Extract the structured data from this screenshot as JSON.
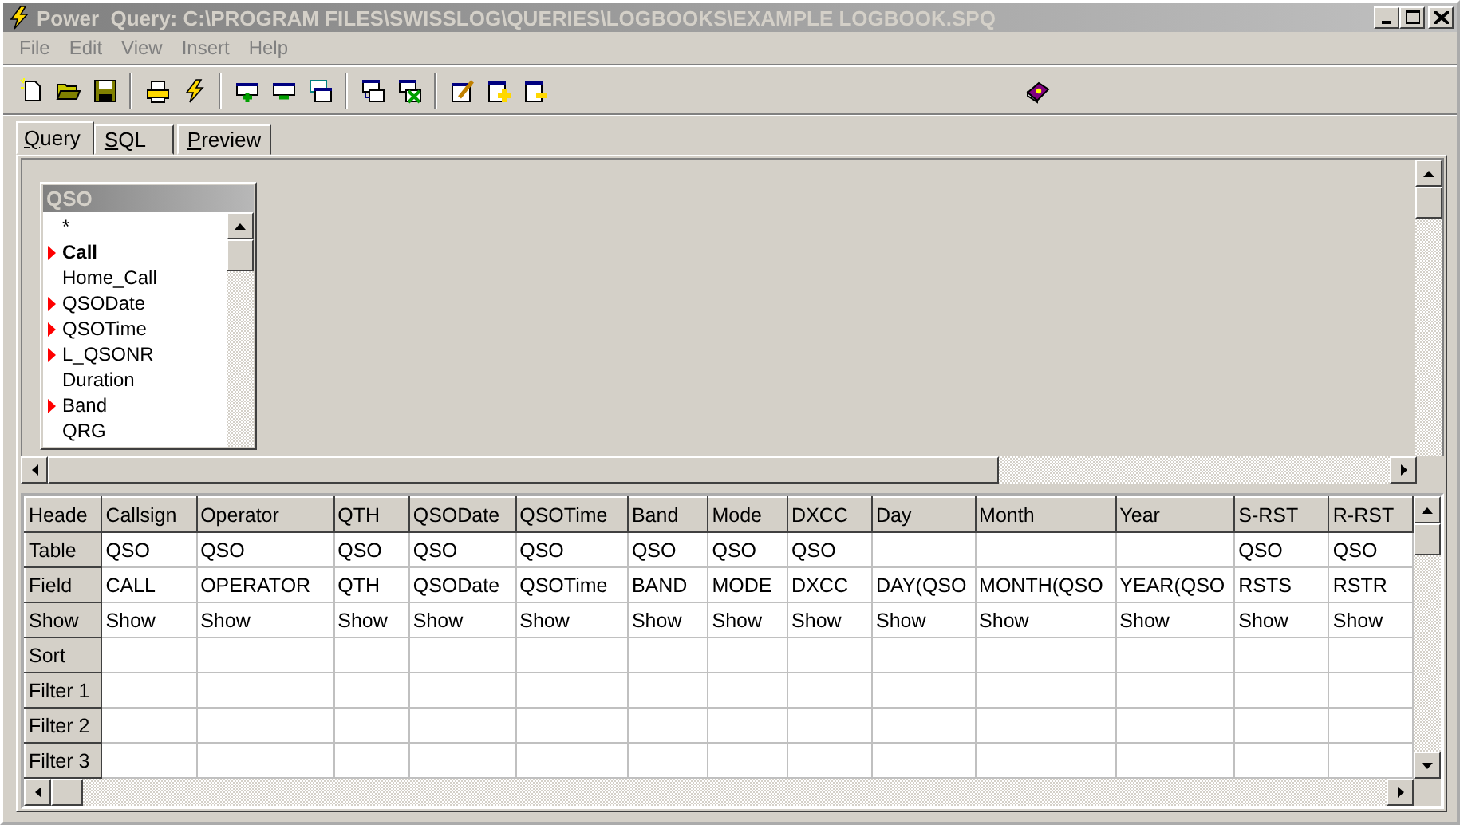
{
  "window": {
    "title": "Power  Query: C:\\PROGRAM FILES\\SWISSLOG\\QUERIES\\LOGBOOKS\\EXAMPLE LOGBOOK.SPQ",
    "active": false
  },
  "menu": [
    "File",
    "Edit",
    "View",
    "Insert",
    "Help"
  ],
  "tabs": [
    {
      "label": "Query",
      "selected": true
    },
    {
      "label": "SQL",
      "selected": false
    },
    {
      "label": "Preview",
      "selected": false
    }
  ],
  "table_box": {
    "title": "QSO",
    "fields": [
      {
        "name": "*",
        "marked": false,
        "bold": false
      },
      {
        "name": "Call",
        "marked": true,
        "bold": true
      },
      {
        "name": "Home_Call",
        "marked": false,
        "bold": false
      },
      {
        "name": "QSODate",
        "marked": true,
        "bold": false
      },
      {
        "name": "QSOTime",
        "marked": true,
        "bold": false
      },
      {
        "name": "L_QSONR",
        "marked": true,
        "bold": false
      },
      {
        "name": "Duration",
        "marked": false,
        "bold": false
      },
      {
        "name": "Band",
        "marked": true,
        "bold": false
      },
      {
        "name": "QRG",
        "marked": false,
        "bold": false
      }
    ]
  },
  "grid": {
    "row_header": "Heade",
    "columns": [
      "Callsign",
      "Operator",
      "QTH",
      "QSODate",
      "QSOTime",
      "Band",
      "Mode",
      "DXCC",
      "Day",
      "Month",
      "Year",
      "S-RST",
      "R-RST"
    ],
    "rows": [
      {
        "label": "Table",
        "cells": [
          "QSO",
          "QSO",
          "QSO",
          "QSO",
          "QSO",
          "QSO",
          "QSO",
          "QSO",
          null,
          null,
          null,
          "QSO",
          "QSO"
        ]
      },
      {
        "label": "Field",
        "cells": [
          "CALL",
          "OPERATOR",
          "QTH",
          "QSODate",
          "QSOTime",
          "BAND",
          "MODE",
          "DXCC",
          "DAY(QSO",
          "MONTH(QSO",
          "YEAR(QSO",
          "RSTS",
          "RSTR"
        ]
      },
      {
        "label": "Show",
        "cells": [
          "Show",
          "Show",
          "Show",
          "Show",
          "Show",
          "Show",
          "Show",
          "Show",
          "Show",
          "Show",
          "Show",
          "Show",
          "Show"
        ]
      },
      {
        "label": "Sort",
        "cells": []
      },
      {
        "label": "Filter 1",
        "cells": []
      },
      {
        "label": "Filter 2",
        "cells": []
      },
      {
        "label": "Filter 3",
        "cells": []
      }
    ]
  }
}
